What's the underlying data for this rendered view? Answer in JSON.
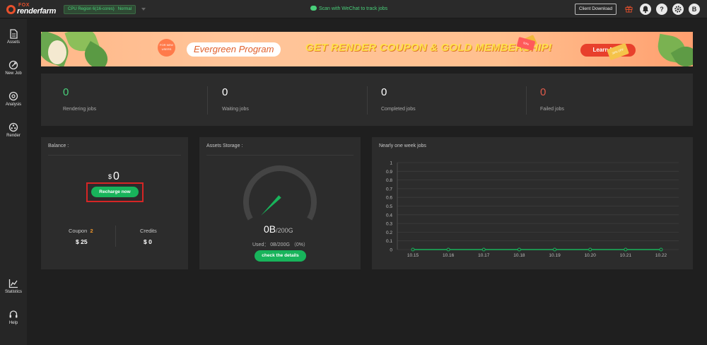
{
  "brand": {
    "fox": "FOX",
    "name": "renderfarm"
  },
  "topbar": {
    "region_label": "CPU Region 6(16-cores)",
    "region_status": "Normal",
    "wechat_text": "Scan with WeChat to track jobs",
    "client_download": "Client Download",
    "avatar_letter": "B",
    "help_glyph": "?"
  },
  "sidebar": {
    "items": [
      {
        "label": "Assets"
      },
      {
        "label": "New Job"
      },
      {
        "label": "Analysis"
      },
      {
        "label": "Render"
      },
      {
        "label": "Statistics"
      },
      {
        "label": "Help"
      }
    ]
  },
  "banner": {
    "tag": "FOR NEW USERS",
    "program": "Evergreen Program",
    "headline": "GET RENDER COUPON & GOLD MEMBERSHIP!",
    "button": "Learn More",
    "ticket_text": "50%",
    "ticket_text_2": "30% OFF"
  },
  "stats": {
    "rendering": {
      "value": "0",
      "label": "Rendering jobs"
    },
    "waiting": {
      "value": "0",
      "label": "Waiting jobs"
    },
    "completed": {
      "value": "0",
      "label": "Completed jobs"
    },
    "failed": {
      "value": "0",
      "label": "Failed jobs"
    }
  },
  "balance": {
    "title": "Balance :",
    "currency": "$",
    "amount": "0",
    "recharge_button": "Recharge now",
    "coupon_label": "Coupon",
    "coupon_count": "2",
    "coupon_value": "$ 25",
    "credits_label": "Credits",
    "credits_value": "$ 0"
  },
  "storage": {
    "title": "Assets Storage :",
    "used": "0B",
    "capacity": "/200G",
    "detail": "Used： 0B/200G （0%）",
    "details_button": "check the details",
    "used_fraction": 0
  },
  "weekly": {
    "title": "Nearly one week jobs"
  },
  "colors": {
    "accent_green": "#18b45b",
    "text_green": "#49d07a",
    "failed_red": "#e05a4a",
    "orange": "#f0962a"
  },
  "chart_data": {
    "type": "line",
    "title": "Nearly one week jobs",
    "x": [
      "10.15",
      "10.16",
      "10.17",
      "10.18",
      "10.19",
      "10.20",
      "10.21",
      "10.22"
    ],
    "series": [
      {
        "values": [
          0,
          0,
          0,
          0,
          0,
          0,
          0,
          0
        ]
      }
    ],
    "yticks": [
      "0",
      "0.1",
      "0.2",
      "0.3",
      "0.4",
      "0.5",
      "0.6",
      "0.7",
      "0.8",
      "0.9",
      "1"
    ],
    "ylim": [
      0,
      1
    ],
    "grid": true,
    "legend": "none"
  }
}
